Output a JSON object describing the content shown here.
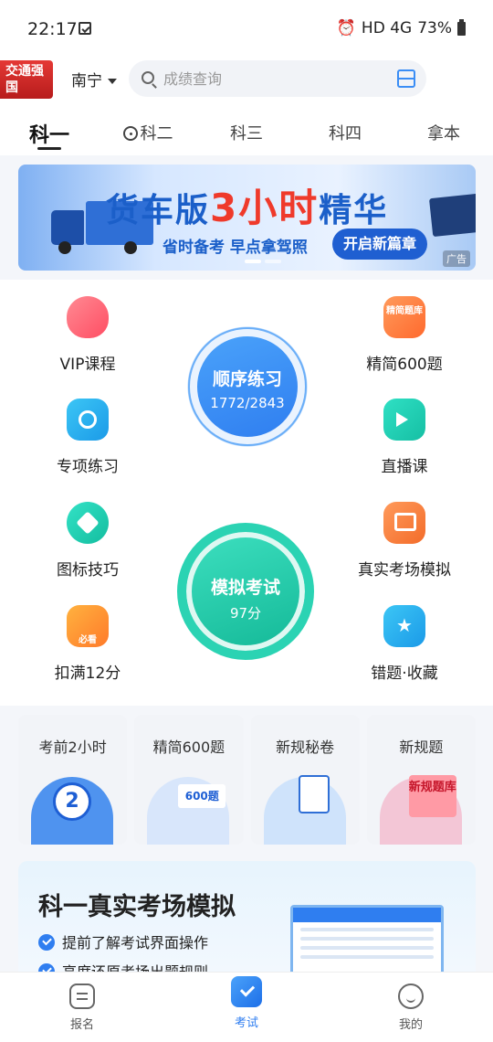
{
  "status_bar": {
    "time": "22:17",
    "network": "HD 4G",
    "battery": "73%"
  },
  "header": {
    "logo_text": "交通强国",
    "city": "南宁",
    "search_placeholder": "成绩查询"
  },
  "tabs": [
    {
      "label": "科一",
      "active": true
    },
    {
      "label": "科二",
      "active": false
    },
    {
      "label": "科三",
      "active": false
    },
    {
      "label": "科四",
      "active": false
    },
    {
      "label": "拿本",
      "active": false
    }
  ],
  "banner": {
    "headline_part1": "货车版",
    "headline_part2": "3小时",
    "headline_part3": "精华",
    "subtitle": "省时备考 早点拿驾照",
    "cta": "开启新篇章",
    "ad_label": "广告",
    "page_index": 1,
    "page_count": 2
  },
  "features_left": [
    {
      "label": "VIP课程",
      "icon": "vip-icon"
    },
    {
      "label": "专项练习",
      "icon": "target-icon"
    },
    {
      "label": "图标技巧",
      "icon": "sign-icon"
    },
    {
      "label": "扣满12分",
      "icon": "must-see-icon",
      "badge": "必看"
    }
  ],
  "features_right": [
    {
      "label": "精简600题",
      "icon": "question-bank-icon",
      "badge": "精简题库"
    },
    {
      "label": "直播课",
      "icon": "live-video-icon"
    },
    {
      "label": "真实考场模拟",
      "icon": "monitor-icon"
    },
    {
      "label": "错题·收藏",
      "icon": "star-bookmark-icon"
    }
  ],
  "sequential_practice": {
    "title": "顺序练习",
    "progress": "1772/2843",
    "done": 1772,
    "total": 2843
  },
  "mock_exam": {
    "title": "模拟考试",
    "score": "97分"
  },
  "cards": [
    {
      "title": "考前2小时",
      "art_text": "2"
    },
    {
      "title": "精简600题",
      "art_text": "600题"
    },
    {
      "title": "新规秘卷",
      "art_text": ""
    },
    {
      "title": "新规题",
      "art_text": "新规题库"
    }
  ],
  "promo": {
    "title": "科一真实考场模拟",
    "items": [
      "提前了解考试界面操作",
      "高度还原考场出题规则"
    ]
  },
  "bottom_nav": [
    {
      "label": "报名",
      "active": false
    },
    {
      "label": "考试",
      "active": true
    },
    {
      "label": "我的",
      "active": false
    }
  ],
  "colors": {
    "accent": "#2f7ef0",
    "green": "#1fc8a8",
    "orange": "#ff7a2e",
    "red": "#ef3a2b"
  }
}
